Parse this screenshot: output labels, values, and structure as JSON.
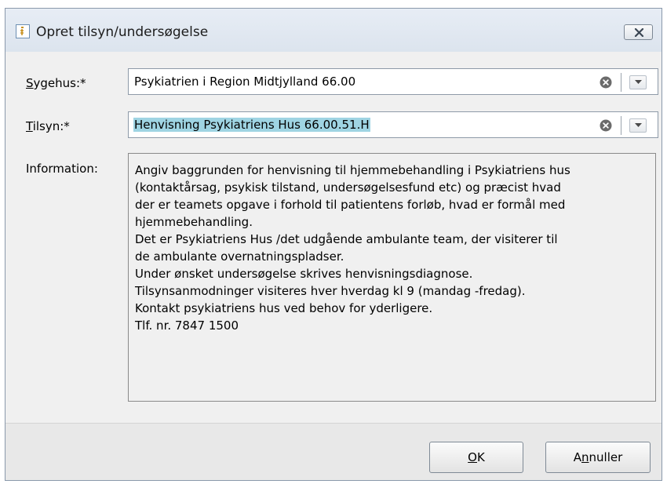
{
  "window": {
    "title": "Opret tilsyn/undersøgelse"
  },
  "form": {
    "hospital": {
      "label_mnemonic": "S",
      "label_rest": "ygehus:*",
      "value": "Psykiatrien i Region Midtjylland 66.00"
    },
    "supervision": {
      "label_mnemonic": "T",
      "label_rest": "ilsyn:*",
      "value": "Henvisning Psykiatriens Hus 66.00.51.H"
    },
    "information": {
      "label": "Information:",
      "lines": [
        "Angiv baggrunden for henvisning til hjemmebehandling i Psykiatriens hus",
        "(kontaktårsag, psykisk tilstand, undersøgelsesfund etc) og præcist hvad",
        "der er teamets opgave i forhold til patientens forløb, hvad er formål med",
        "hjemmebehandling.",
        "Det er Psykiatriens Hus /det udgående ambulante team, der visiterer til",
        "de ambulante overnatningspladser.",
        "Under ønsket undersøgelse skrives henvisningsdiagnose.",
        "Tilsynsanmodninger visiteres hver hverdag kl 9 (mandag -fredag).",
        "Kontakt psykiatriens hus ved behov for yderligere.",
        "Tlf. nr. 7847 1500"
      ]
    }
  },
  "buttons": {
    "ok_mnemonic": "O",
    "ok_rest": "K",
    "cancel_pre": "A",
    "cancel_mnemonic": "n",
    "cancel_rest": "nuller"
  },
  "icons": {
    "title": "document-icon",
    "close": "close-icon",
    "clear": "clear-icon",
    "dropdown": "chevron-down-icon"
  },
  "colors": {
    "selection": "#9fd4e3",
    "window_bg": "#f0f0f0"
  }
}
